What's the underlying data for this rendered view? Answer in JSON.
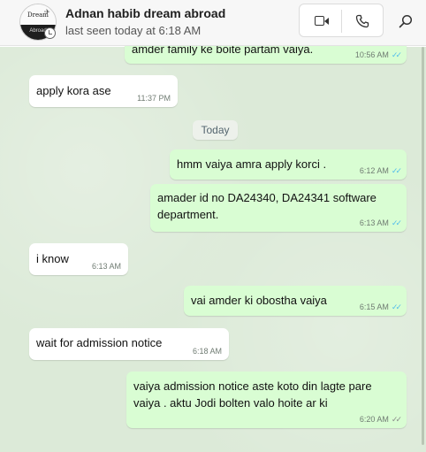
{
  "contact": {
    "name": "Adnan habib dream abroad",
    "status": "last seen today at 6:18 AM",
    "avatar_line1": "Dream",
    "avatar_line2": "Abroad"
  },
  "date_separator": "Today",
  "messages": [
    {
      "text": "amder family ke boite partam vaiya.",
      "time": "10:56 AM",
      "ticks": "✓✓"
    },
    {
      "text": "apply kora ase",
      "time": "11:37 PM"
    },
    {
      "text": "hmm vaiya amra apply korci .",
      "time": "6:12 AM",
      "ticks": "✓✓"
    },
    {
      "text": "amader id no DA24340, DA24341 software department.",
      "time": "6:13 AM",
      "ticks": "✓✓"
    },
    {
      "text": "i know",
      "time": "6:13 AM"
    },
    {
      "text": "vai amder ki obostha vaiya",
      "time": "6:15 AM",
      "ticks": "✓✓"
    },
    {
      "text": "wait for admission notice",
      "time": "6:18 AM"
    },
    {
      "text": "vaiya admission notice aste koto din lagte pare vaiya . aktu Jodi bolten valo hoite ar ki",
      "time": "6:20 AM",
      "ticks": "✓✓"
    }
  ],
  "colors": {
    "incoming": "#ffffff",
    "outgoing": "#d9fdd3",
    "chat_background": "#dcead8",
    "read_ticks": "#53bdeb",
    "sent_ticks": "#8a8a8a"
  },
  "icons": {
    "video": "video-call-icon",
    "phone": "phone-icon",
    "search": "search-icon"
  }
}
